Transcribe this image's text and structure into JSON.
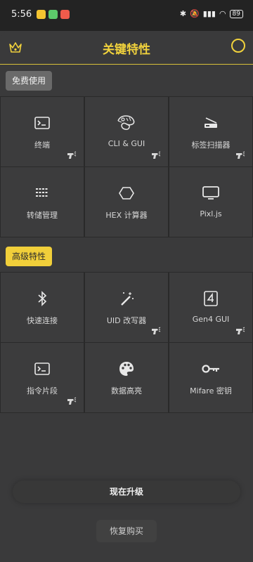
{
  "status": {
    "time": "5:56",
    "battery": "89",
    "app_colors": [
      "#f4c430",
      "#5cc96b",
      "#ef5b4b"
    ]
  },
  "header": {
    "title": "关键特性"
  },
  "sections": {
    "free_label": "免费使用",
    "pro_label": "高级特性"
  },
  "free_tiles": [
    {
      "label": "终端",
      "icon": "terminal-icon",
      "marked": true
    },
    {
      "label": "CLI & GUI",
      "icon": "chameleon-icon",
      "marked": true
    },
    {
      "label": "标签扫描器",
      "icon": "scanner-icon",
      "marked": true
    },
    {
      "label": "转储管理",
      "icon": "dump-icon",
      "marked": false
    },
    {
      "label": "HEX 计算器",
      "icon": "hexagon-icon",
      "marked": false
    },
    {
      "label": "Pixl.js",
      "icon": "monitor-icon",
      "marked": false
    }
  ],
  "pro_tiles": [
    {
      "label": "快速连接",
      "icon": "bluetooth-icon",
      "marked": false
    },
    {
      "label": "UID 改写器",
      "icon": "magic-wand-icon",
      "marked": true
    },
    {
      "label": "Gen4 GUI",
      "icon": "number-4-icon",
      "marked": true
    },
    {
      "label": "指令片段",
      "icon": "terminal-icon",
      "marked": true
    },
    {
      "label": "数据高亮",
      "icon": "palette-icon",
      "marked": false
    },
    {
      "label": "Mifare 密钥",
      "icon": "key-icon",
      "marked": false
    }
  ],
  "buttons": {
    "upgrade": "现在升级",
    "restore": "恢复购买"
  },
  "colors": {
    "accent": "#f1d23c",
    "background": "#3a3a3b"
  }
}
